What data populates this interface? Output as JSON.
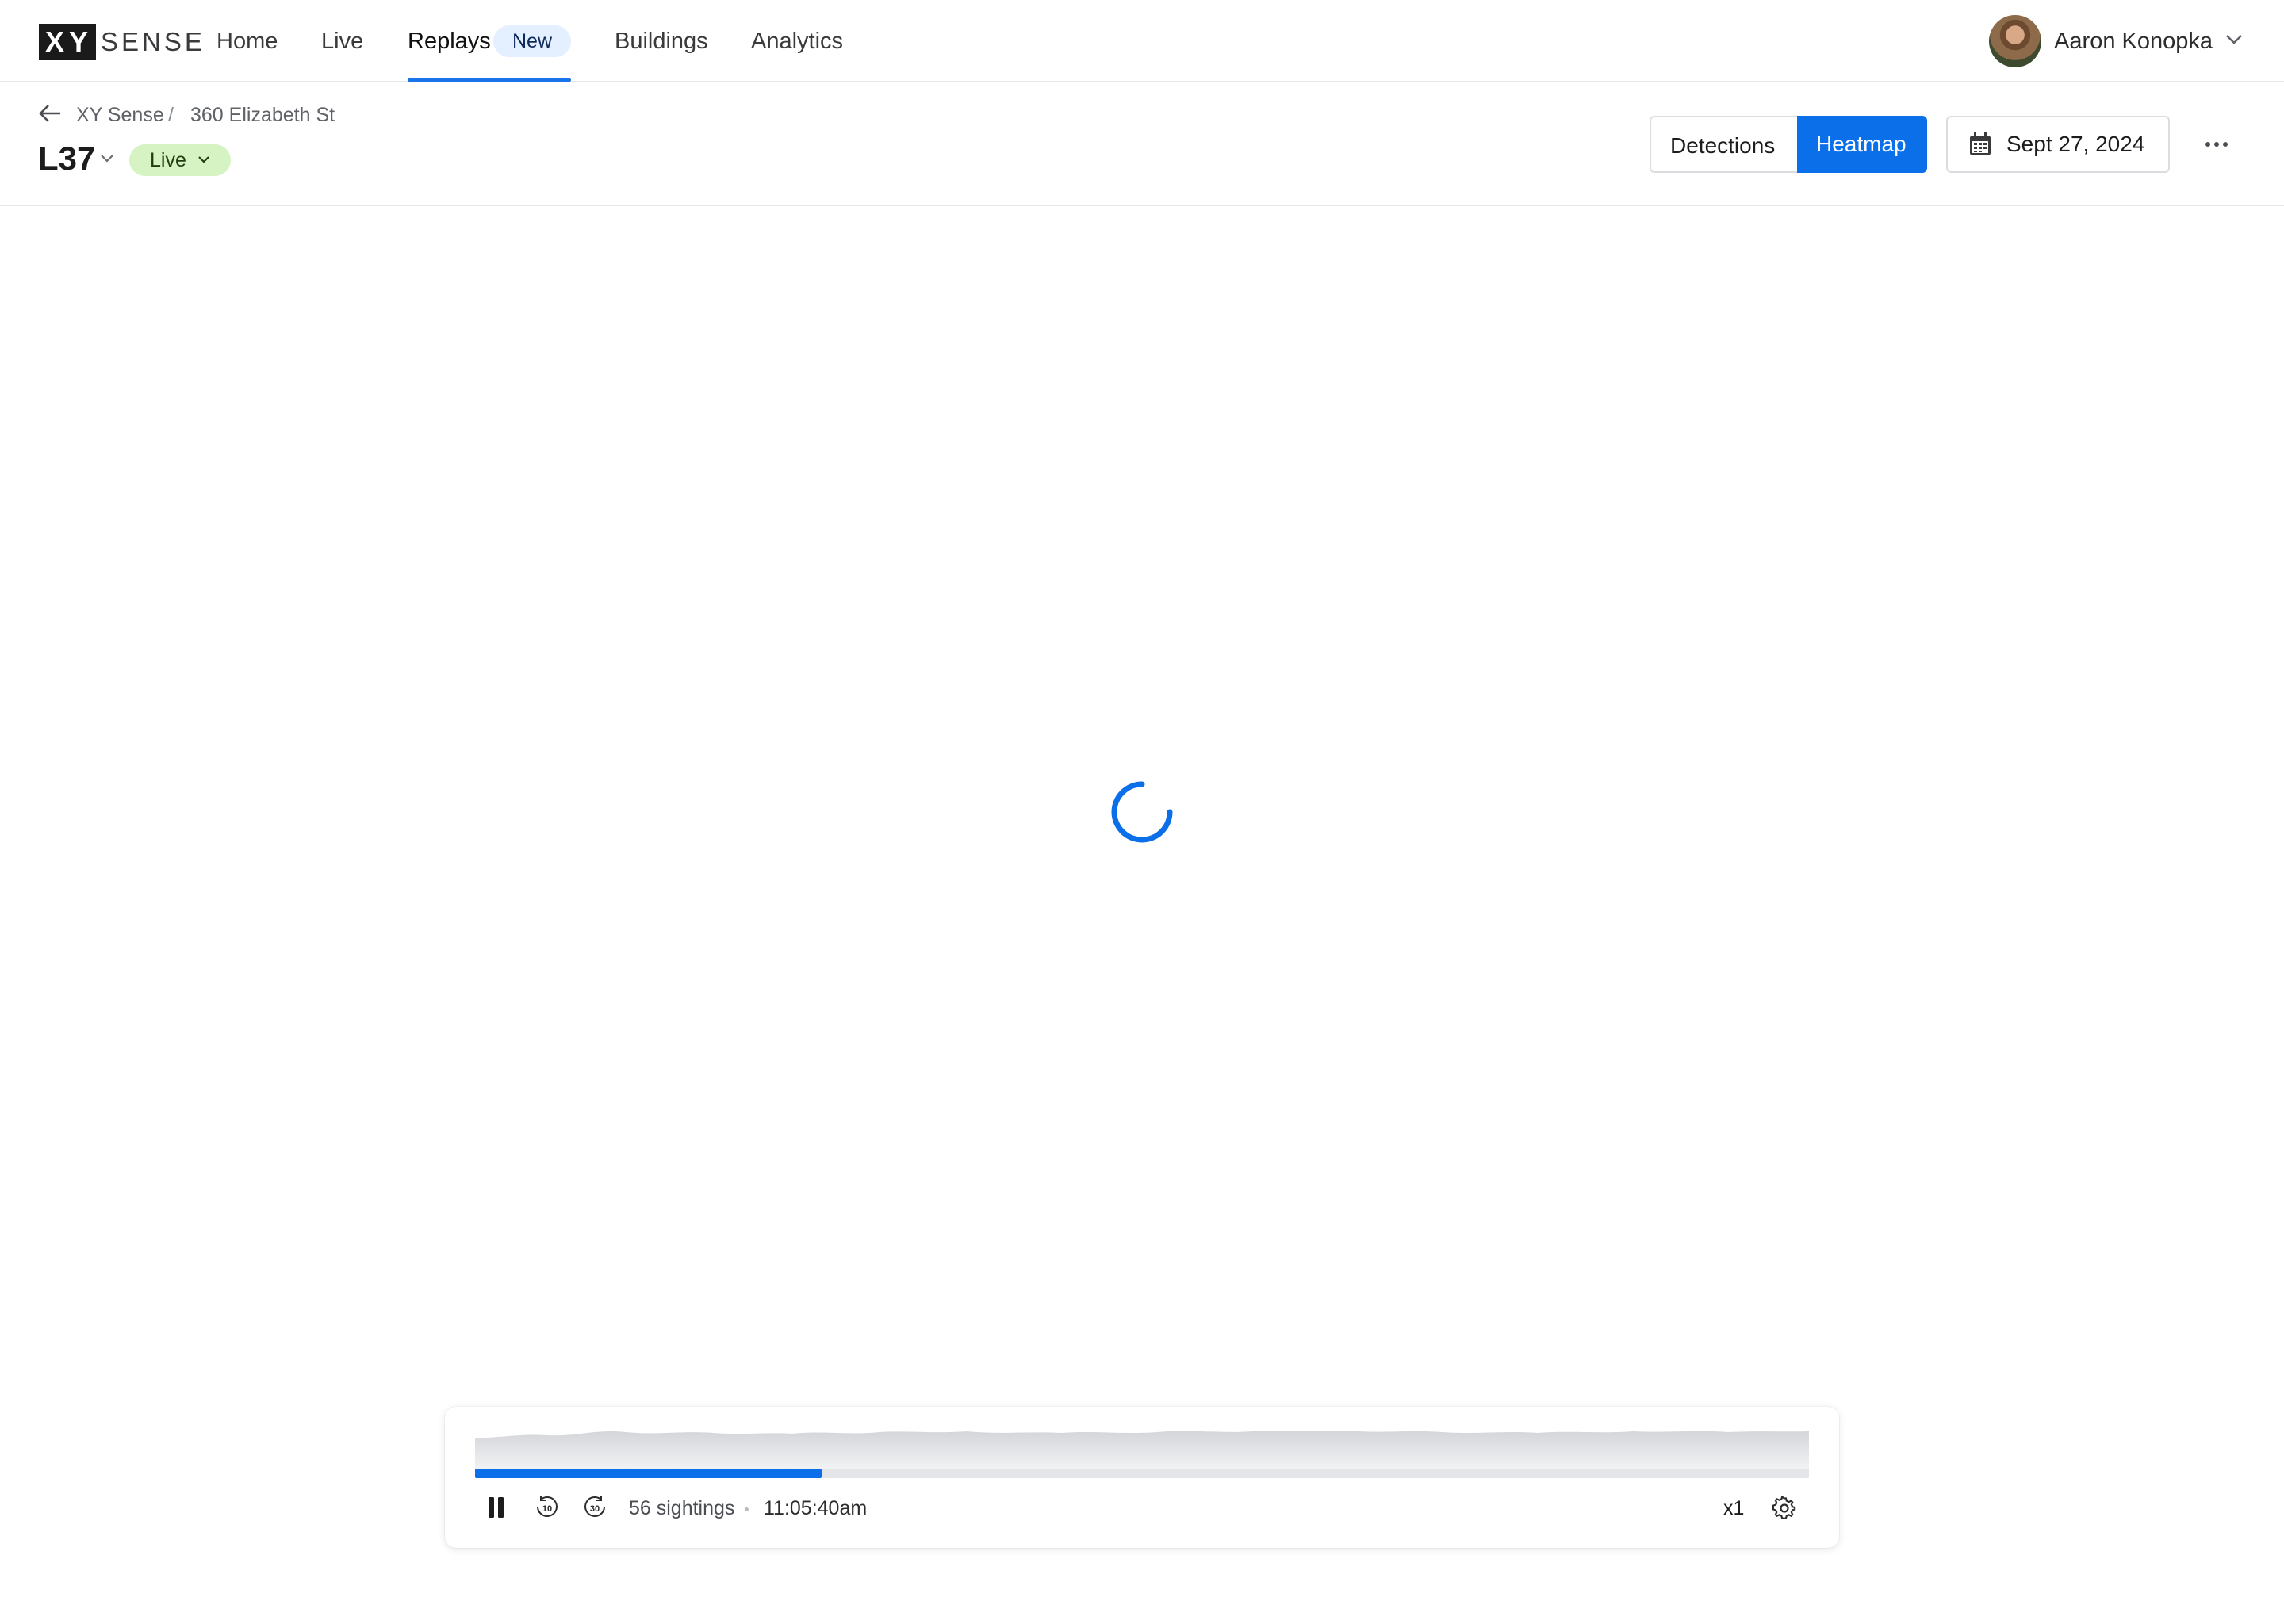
{
  "brand": {
    "logo_box": "XY",
    "logo_word": "SENSE"
  },
  "nav": {
    "items": [
      {
        "label": "Home"
      },
      {
        "label": "Live"
      },
      {
        "label": "Replays",
        "badge": "New",
        "active": true
      },
      {
        "label": "Buildings"
      },
      {
        "label": "Analytics"
      }
    ]
  },
  "user": {
    "name": "Aaron Konopka"
  },
  "breadcrumb": {
    "items": [
      "XY Sense",
      "360 Elizabeth St"
    ],
    "separator": "/"
  },
  "floor": {
    "name": "L37",
    "status": "Live"
  },
  "view_toggle": {
    "options": [
      "Detections",
      "Heatmap"
    ],
    "selected": "Heatmap"
  },
  "date_picker": {
    "value": "Sept 27, 2024"
  },
  "player": {
    "sightings": "56 sightings",
    "time": "11:05:40am",
    "speed": "x1",
    "progress": 0.26
  },
  "colors": {
    "accent": "#0a6fe8",
    "live_pill": "#d6f3c4",
    "new_badge": "#e4efff"
  },
  "icons": [
    "back-arrow-icon",
    "chevron-down-icon",
    "calendar-icon",
    "more-icon",
    "spinner-icon",
    "pause-icon",
    "rewind-10-icon",
    "forward-30-icon",
    "settings-gear-icon"
  ]
}
